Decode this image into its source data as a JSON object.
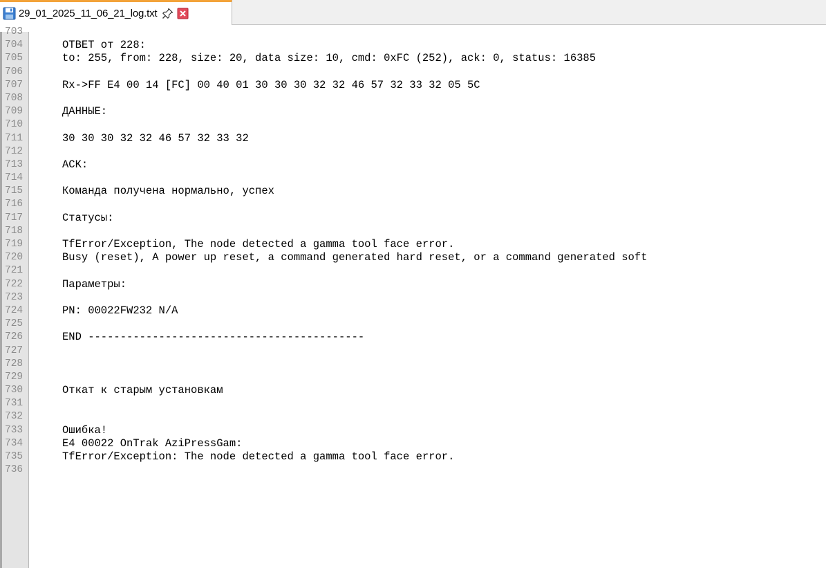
{
  "tab": {
    "title": "29_01_2025_11_06_21_log.txt",
    "accent": "#f3a33a",
    "icons": [
      "save-icon",
      "pin-icon",
      "close-icon"
    ]
  },
  "editor": {
    "lines": [
      {
        "num": "703",
        "text": ""
      },
      {
        "num": "704",
        "text": "ОТВЕТ от 228:"
      },
      {
        "num": "705",
        "text": "to: 255, from: 228, size: 20, data size: 10, cmd: 0xFC (252), ack: 0, status: 16385"
      },
      {
        "num": "706",
        "text": ""
      },
      {
        "num": "707",
        "text": "Rx->FF E4 00 14 [FC] 00 40 01 30 30 30 32 32 46 57 32 33 32 05 5C"
      },
      {
        "num": "708",
        "text": ""
      },
      {
        "num": "709",
        "text": "ДАННЫЕ:"
      },
      {
        "num": "710",
        "text": ""
      },
      {
        "num": "711",
        "text": "30 30 30 32 32 46 57 32 33 32"
      },
      {
        "num": "712",
        "text": ""
      },
      {
        "num": "713",
        "text": "ACK:"
      },
      {
        "num": "714",
        "text": ""
      },
      {
        "num": "715",
        "text": "Команда получена нормально, успех"
      },
      {
        "num": "716",
        "text": ""
      },
      {
        "num": "717",
        "text": "Статусы:"
      },
      {
        "num": "718",
        "text": ""
      },
      {
        "num": "719",
        "text": "TfError/Exception, The node detected a gamma tool face error."
      },
      {
        "num": "720",
        "text": "Busy (reset), A power up reset, a command generated hard reset, or a command generated soft"
      },
      {
        "num": "721",
        "text": ""
      },
      {
        "num": "722",
        "text": "Параметры:"
      },
      {
        "num": "723",
        "text": ""
      },
      {
        "num": "724",
        "text": "PN: 00022FW232 N/A"
      },
      {
        "num": "725",
        "text": ""
      },
      {
        "num": "726",
        "text": "END -------------------------------------------"
      },
      {
        "num": "727",
        "text": ""
      },
      {
        "num": "728",
        "text": ""
      },
      {
        "num": "729",
        "text": ""
      },
      {
        "num": "730",
        "text": "Откат к старым установкам"
      },
      {
        "num": "731",
        "text": ""
      },
      {
        "num": "732",
        "text": ""
      },
      {
        "num": "733",
        "text": "Ошибка!"
      },
      {
        "num": "734",
        "text": "E4 00022 OnTrak AziPressGam:"
      },
      {
        "num": "735",
        "text": "TfError/Exception: The node detected a gamma tool face error."
      },
      {
        "num": "736",
        "text": ""
      }
    ]
  }
}
